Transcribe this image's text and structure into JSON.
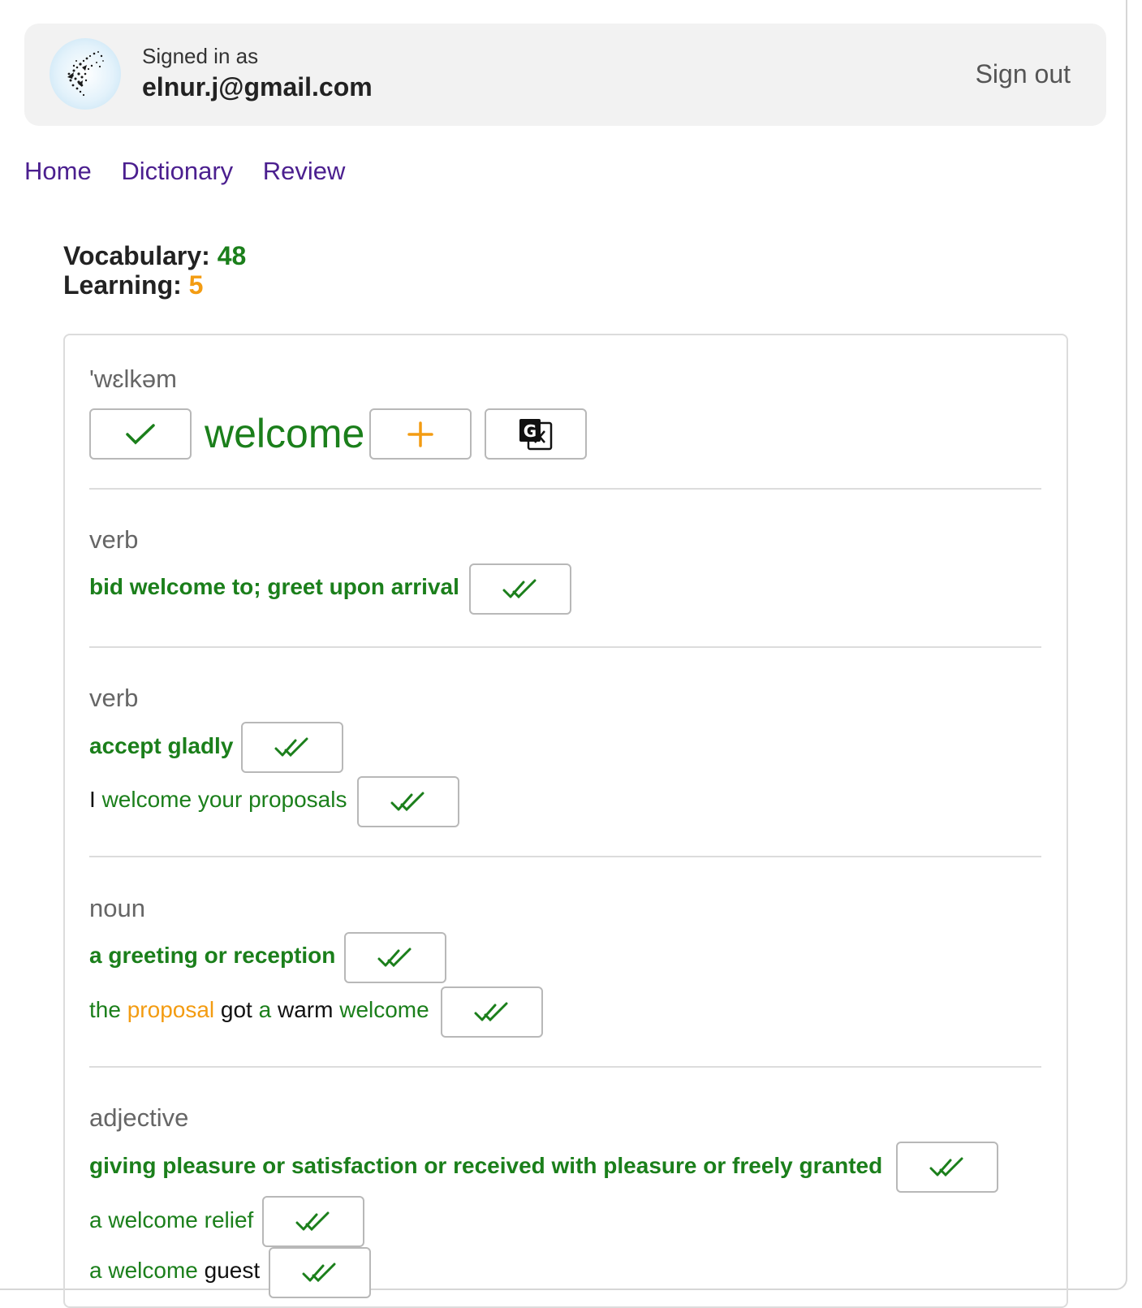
{
  "header": {
    "signed_in_label": "Signed in as",
    "email": "elnur.j@gmail.com",
    "sign_out": "Sign out"
  },
  "nav": [
    "Home",
    "Dictionary",
    "Review"
  ],
  "stats": {
    "vocabulary_label": "Vocabulary:",
    "vocabulary_value": "48",
    "learning_label": "Learning:",
    "learning_value": "5"
  },
  "entry": {
    "phonetic": "'wɛlkəm",
    "word": "welcome",
    "known_icon": "checkmark-icon",
    "add_icon": "plus-icon",
    "translate_icon": "google-translate-icon",
    "senses": [
      {
        "pos": "verb",
        "definition": "bid welcome to; greet upon arrival",
        "examples": []
      },
      {
        "pos": "verb",
        "definition": "accept gladly",
        "examples": [
          {
            "parts": [
              "I",
              "welcome your proposals"
            ]
          }
        ]
      },
      {
        "pos": "noun",
        "definition": "a greeting or reception",
        "examples": [
          {
            "parts": [
              "the",
              "proposal",
              "got",
              "a",
              "warm",
              "welcome"
            ]
          }
        ]
      },
      {
        "pos": "adjective",
        "definition": "giving pleasure or satisfaction or received with pleasure or freely granted",
        "examples": [
          {
            "parts": [
              "a welcome relief"
            ]
          },
          {
            "parts": [
              "a welcome",
              "guest"
            ]
          }
        ]
      }
    ],
    "mark_known_icon": "double-check-icon"
  },
  "colors": {
    "green": "#1b7f1b",
    "orange": "#f39c12",
    "nav_purple": "#4b1f8f"
  }
}
